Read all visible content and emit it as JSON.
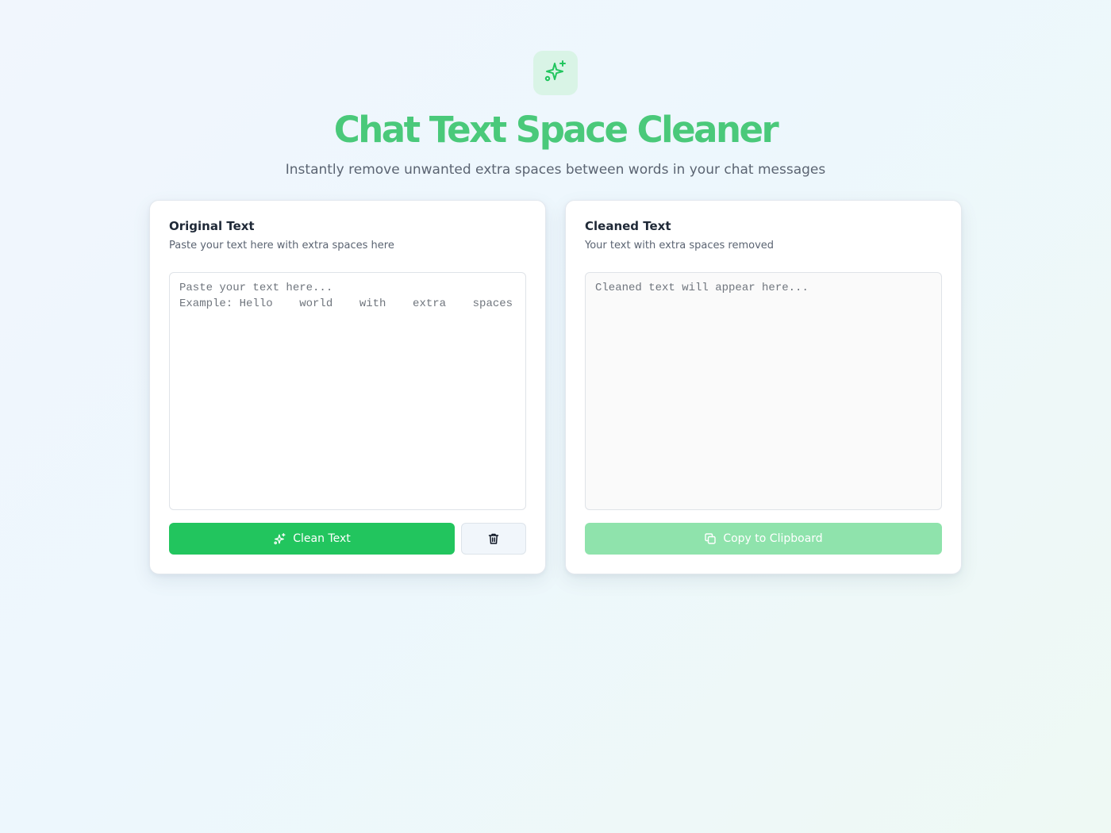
{
  "header": {
    "logo_icon": "sparkles-icon",
    "title": "Chat Text Space Cleaner",
    "subtitle": "Instantly remove unwanted extra spaces between words in your chat messages"
  },
  "original": {
    "title": "Original Text",
    "description": "Paste your text here with extra spaces here",
    "value": "",
    "placeholder": "Paste your text here...\nExample: Hello    world    with    extra    spaces",
    "clean_button_label": "Clean Text",
    "clean_button_icon": "sparkles-icon",
    "clear_button_icon": "trash-icon"
  },
  "cleaned": {
    "title": "Cleaned Text",
    "description": "Your text with extra spaces removed",
    "value": "",
    "placeholder": "Cleaned text will appear here...",
    "copy_button_label": "Copy to Clipboard",
    "copy_button_icon": "copy-icon"
  },
  "colors": {
    "accent": "#22c55e",
    "title": "#4ac97a",
    "accent_disabled": "#8fe3ac"
  }
}
